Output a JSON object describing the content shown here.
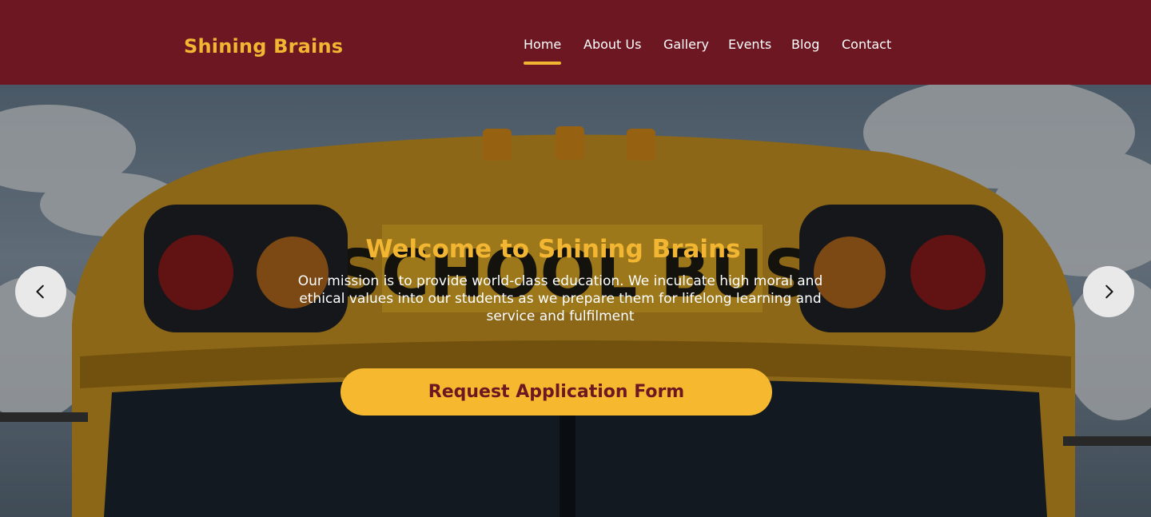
{
  "header": {
    "brand": "Shining Brains",
    "nav": [
      {
        "label": "Home",
        "active": true
      },
      {
        "label": "About Us",
        "active": false
      },
      {
        "label": "Gallery",
        "active": false
      },
      {
        "label": "Events",
        "active": false
      },
      {
        "label": "Blog",
        "active": false
      },
      {
        "label": "Contact",
        "active": false
      }
    ]
  },
  "hero": {
    "background_sign": "SCHOOL BUS",
    "title": "Welcome to  Shining Brains",
    "description": "Our mission is to provide world-class education. We inculcate high moral and ethical values into our students as we prepare them for lifelong learning and service and fulfilment",
    "cta_label": "Request Application Form",
    "prev_icon": "chevron-left-icon",
    "next_icon": "chevron-right-icon"
  },
  "colors": {
    "brand_maroon": "#6d1722",
    "accent_gold": "#f2b632",
    "button_gold": "#f5b82e",
    "arrow_bg": "#e9e9e9"
  }
}
